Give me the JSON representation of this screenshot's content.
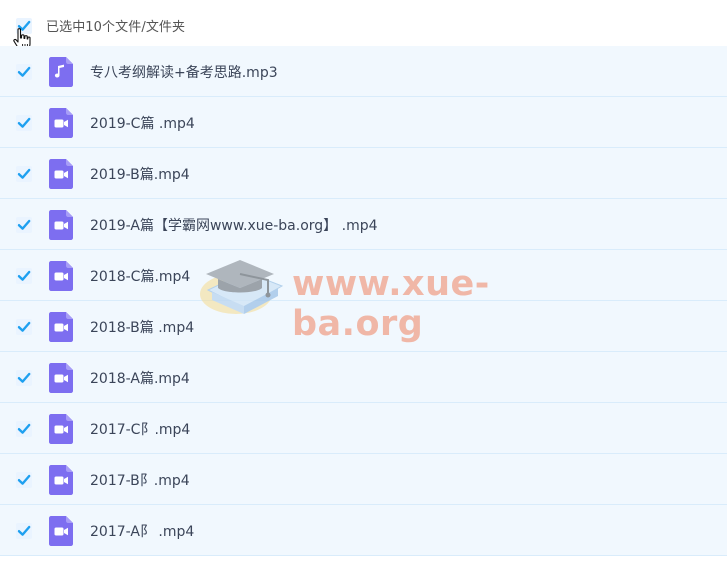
{
  "header": {
    "selected_label": "已选中10个文件/文件夹",
    "all_checked": true
  },
  "colors": {
    "row_bg": "#f1f8fe",
    "check_accent": "#1ea0f0",
    "audio_icon": "#7d6ef0",
    "video_icon": "#7d6ef0",
    "watermark": "#f0a892"
  },
  "files": [
    {
      "name": "专八考纲解读+备考思路.mp3",
      "type": "audio",
      "icon": "music-note-icon",
      "checked": true
    },
    {
      "name": "2019-C篇 .mp4",
      "type": "video",
      "icon": "video-camera-icon",
      "checked": true
    },
    {
      "name": "2019-B篇.mp4",
      "type": "video",
      "icon": "video-camera-icon",
      "checked": true
    },
    {
      "name": "2019-A篇【学霸网www.xue-ba.org】 .mp4",
      "type": "video",
      "icon": "video-camera-icon",
      "checked": true
    },
    {
      "name": "2018-C篇.mp4",
      "type": "video",
      "icon": "video-camera-icon",
      "checked": true
    },
    {
      "name": "2018-B篇 .mp4",
      "type": "video",
      "icon": "video-camera-icon",
      "checked": true
    },
    {
      "name": "2018-A篇.mp4",
      "type": "video",
      "icon": "video-camera-icon",
      "checked": true
    },
    {
      "name": "2017-C⻖.mp4",
      "type": "video",
      "icon": "video-camera-icon",
      "checked": true
    },
    {
      "name": "2017-B⻖.mp4",
      "type": "video",
      "icon": "video-camera-icon",
      "checked": true
    },
    {
      "name": "2017-A⻖ .mp4",
      "type": "video",
      "icon": "video-camera-icon",
      "checked": true
    }
  ],
  "watermark": {
    "text": "www.xue-ba.org"
  }
}
